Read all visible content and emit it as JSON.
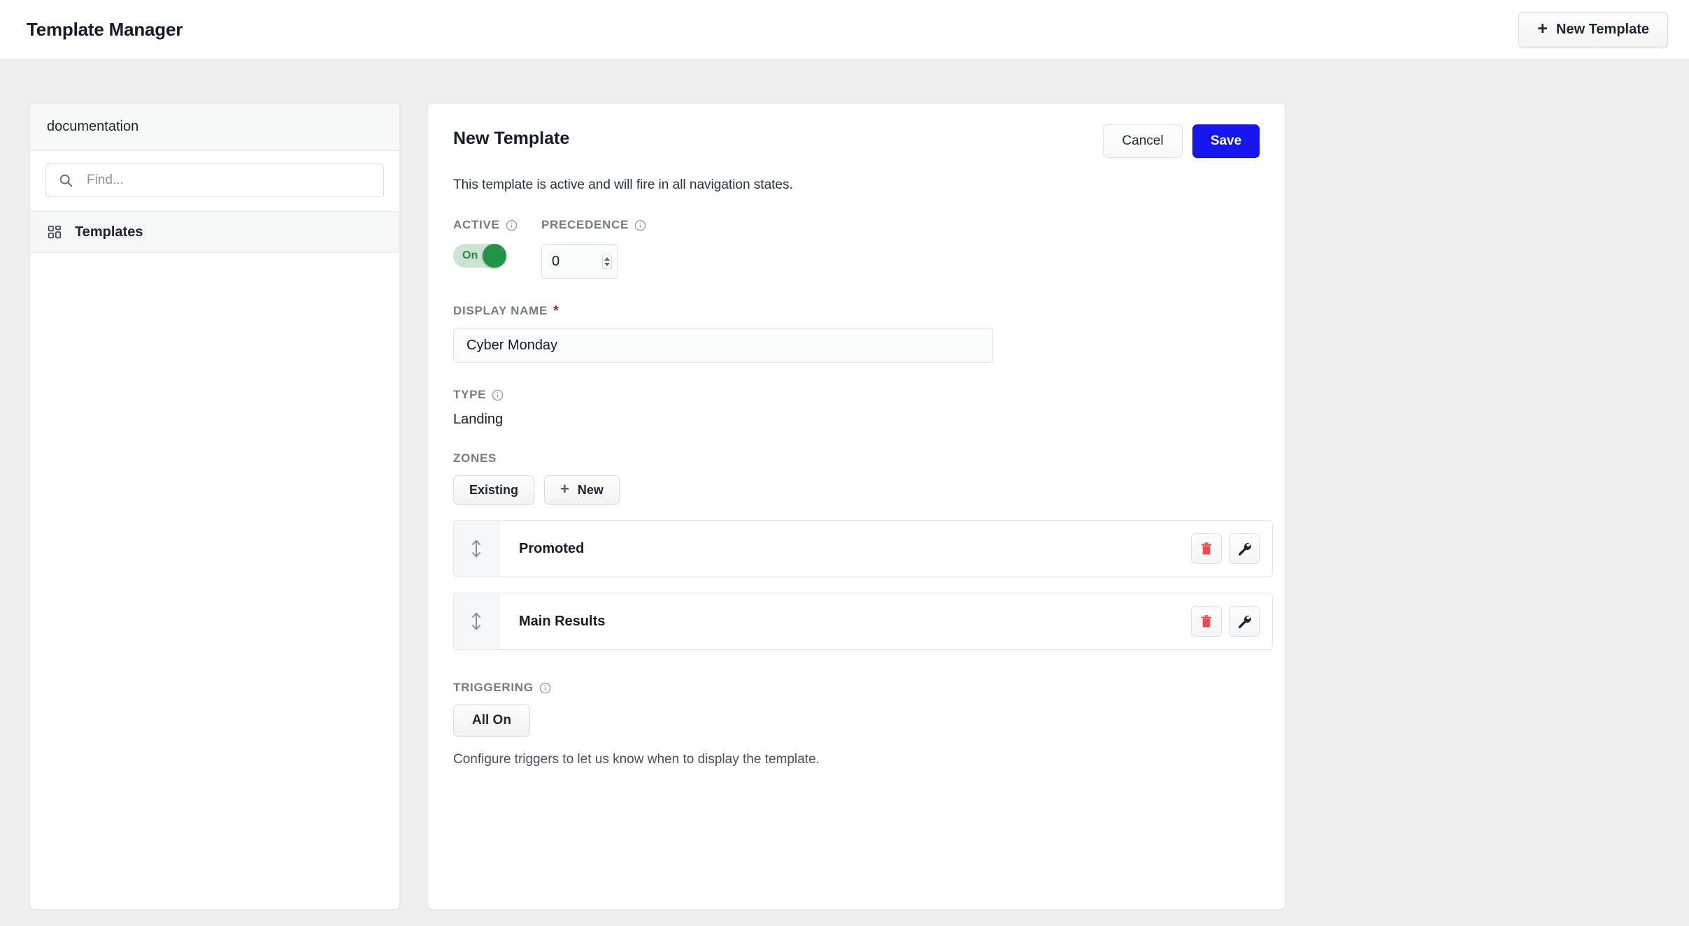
{
  "header": {
    "title": "Template Manager",
    "new_template_label": "New Template",
    "plus_glyph": "+"
  },
  "sidebar": {
    "header_label": "documentation",
    "search": {
      "placeholder": "Find...",
      "value": ""
    },
    "items": [
      {
        "label": "Templates",
        "icon": "grid-icon"
      }
    ]
  },
  "main": {
    "title": "New Template",
    "cancel_label": "Cancel",
    "save_label": "Save",
    "status_text": "This template is active and will fire in all navigation states.",
    "active": {
      "label": "ACTIVE",
      "toggle_state": "On"
    },
    "precedence": {
      "label": "PRECEDENCE",
      "value": "0"
    },
    "display_name": {
      "label": "DISPLAY NAME",
      "required_marker": "*",
      "value": "Cyber Monday"
    },
    "type": {
      "label": "TYPE",
      "value": "Landing"
    },
    "zones": {
      "label": "ZONES",
      "existing_label": "Existing",
      "new_label": "New",
      "plus_glyph": "+",
      "rows": [
        {
          "name": "Promoted"
        },
        {
          "name": "Main Results"
        }
      ]
    },
    "triggering": {
      "label": "TRIGGERING",
      "all_on_label": "All On",
      "helper_text": "Configure triggers to let us know when to display the template."
    }
  },
  "colors": {
    "accent_blue": "#1515f0",
    "toggle_green": "#21954a",
    "toggle_track": "#cde4d4",
    "danger_red": "#ea4a53",
    "required_red": "#b0222e",
    "page_bg": "#eeeeee"
  }
}
